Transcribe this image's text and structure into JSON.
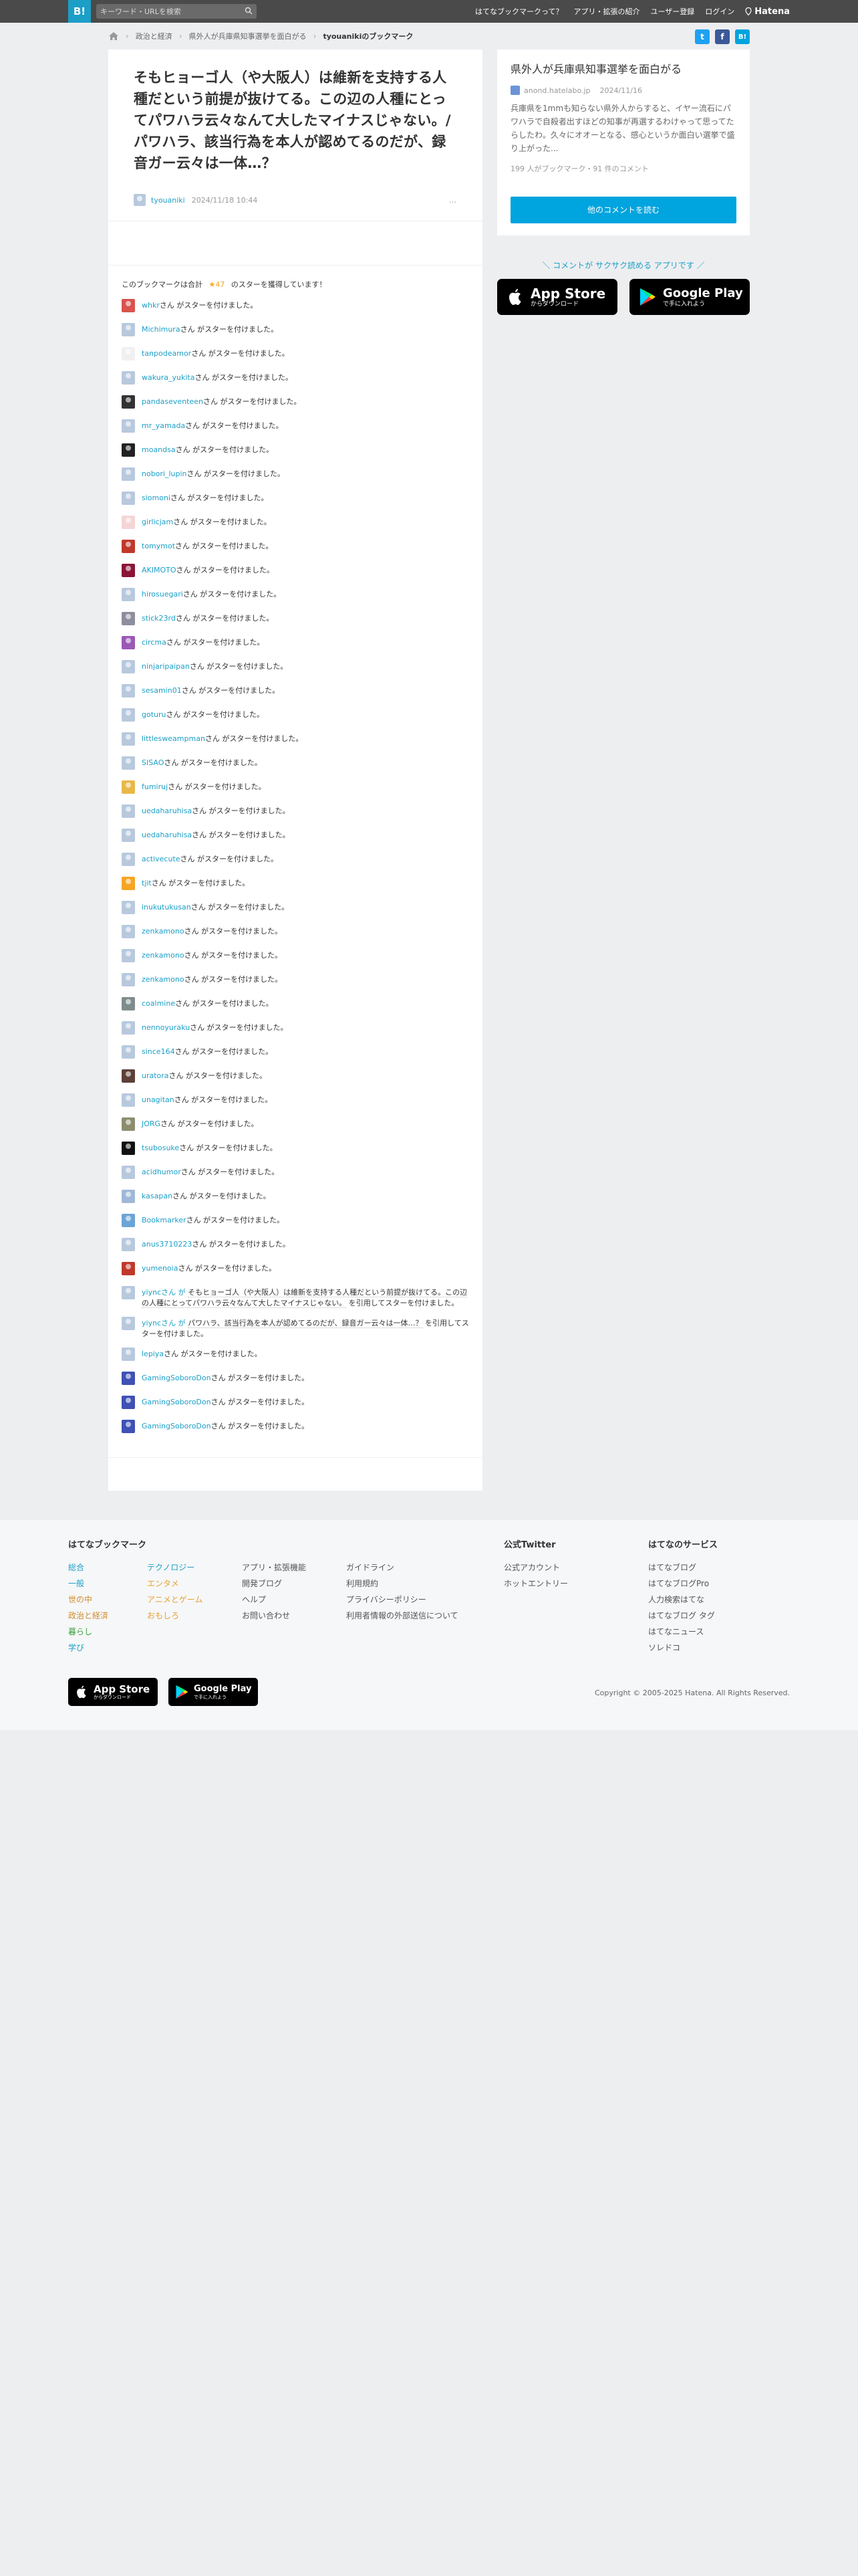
{
  "topbar": {
    "logo": "B!",
    "search_placeholder": "キーワード・URLを検索",
    "nav": [
      "はてなブックマークって？",
      "アプリ・拡張の紹介",
      "ユーザー登録",
      "ログイン"
    ],
    "brand": "Hatena"
  },
  "breadcrumb": {
    "items": [
      "政治と経済",
      "県外人が兵庫県知事選挙を面白がる"
    ],
    "current": "tyouanikiのブックマーク"
  },
  "share": {
    "twitter": "t",
    "facebook": "f",
    "hatena": "B!"
  },
  "entry": {
    "title": "そもヒョーゴ人（や大阪人）は維新を支持する人種だという前提が抜けてる。この辺の人種にとってパワハラ云々なんて大したマイナスじゃない。/パワハラ、該当行為を本人が認めてるのだが、録音ガー云々は一体…？",
    "user": "tyouaniki",
    "date": "2024/11/18 10:44",
    "more": "…"
  },
  "stars": {
    "summary_prefix": "このブックマークは合計",
    "summary_count": "★47",
    "summary_suffix": "のスターを獲得しています！",
    "suffix": "さん がスターを付けました。",
    "rows": [
      {
        "u": "whkr",
        "c": "#d9534f"
      },
      {
        "u": "Michimura",
        "c": "#b8c9de"
      },
      {
        "u": "tanpodeamor",
        "c": "#f0f0f0"
      },
      {
        "u": "wakura_yukita",
        "c": "#b8c9de"
      },
      {
        "u": "pandaseventeen",
        "c": "#333333"
      },
      {
        "u": "mr_yamada",
        "c": "#b8c9de"
      },
      {
        "u": "moandsa",
        "c": "#222222"
      },
      {
        "u": "nobori_lupin",
        "c": "#b8c9de"
      },
      {
        "u": "siomoni",
        "c": "#b8c9de"
      },
      {
        "u": "girlicjam",
        "c": "#f5d5d5"
      },
      {
        "u": "tomymot",
        "c": "#c0392b"
      },
      {
        "u": "AKIMOTO",
        "c": "#8b1538"
      },
      {
        "u": "hirosuegari",
        "c": "#b8c9de"
      },
      {
        "u": "stick23rd",
        "c": "#8e8e9e"
      },
      {
        "u": "circma",
        "c": "#9b59b6"
      },
      {
        "u": "ninjaripaipan",
        "c": "#b8c9de"
      },
      {
        "u": "sesamin01",
        "c": "#b8c9de"
      },
      {
        "u": "goturu",
        "c": "#b8c9de"
      },
      {
        "u": "littlesweampman",
        "c": "#b8c9de"
      },
      {
        "u": "SISAO",
        "c": "#b8c9de"
      },
      {
        "u": "fumiruj",
        "c": "#e8b84a"
      },
      {
        "u": "uedaharuhisa",
        "c": "#b8c9de"
      },
      {
        "u": "uedaharuhisa",
        "c": "#b8c9de"
      },
      {
        "u": "activecute",
        "c": "#b8c9de"
      },
      {
        "u": "tjit",
        "c": "#f5a623"
      },
      {
        "u": "inukutukusan",
        "c": "#b8c9de"
      },
      {
        "u": "zenkamono",
        "c": "#b8c9de"
      },
      {
        "u": "zenkamono",
        "c": "#b8c9de"
      },
      {
        "u": "zenkamono",
        "c": "#b8c9de"
      },
      {
        "u": "coalmine",
        "c": "#7f8c8d"
      },
      {
        "u": "nennoyuraku",
        "c": "#b8c9de"
      },
      {
        "u": "since164",
        "c": "#b8c9de"
      },
      {
        "u": "uratora",
        "c": "#5d4037"
      },
      {
        "u": "unagitan",
        "c": "#b8c9de"
      },
      {
        "u": "JORG",
        "c": "#8d8d6e"
      },
      {
        "u": "tsubosuke",
        "c": "#111111"
      },
      {
        "u": "acidhumor",
        "c": "#b8c9de"
      },
      {
        "u": "kasapan",
        "c": "#a0b8d8"
      },
      {
        "u": "Bookmarker",
        "c": "#6ba5d6"
      },
      {
        "u": "anus3710223",
        "c": "#b8c9de"
      },
      {
        "u": "yumenoia",
        "c": "#c0392b"
      }
    ],
    "quote1": {
      "user": "yiyncさん が",
      "quote": "そもヒョーゴ人（や大阪人）は維新を支持する人種だという前提が抜けてる。この辺の人種にとってパワハラ云々なんて大したマイナスじゃない。",
      "suffix": "を引用してスターを付けました。",
      "c": "#b8c9de"
    },
    "quote2": {
      "user": "yiyncさん が",
      "quote": "パワハラ、該当行為を本人が認めてるのだが、録音ガー云々は一体…？",
      "suffix": "を引用してスターを付けました。",
      "c": "#b8c9de"
    },
    "tail_rows": [
      {
        "u": "lepiya",
        "c": "#b8c9de"
      },
      {
        "u": "GamingSoboroDon",
        "c": "#3f51b5"
      },
      {
        "u": "GamingSoboroDon",
        "c": "#3f51b5"
      },
      {
        "u": "GamingSoboroDon",
        "c": "#3f51b5"
      }
    ]
  },
  "card": {
    "title": "県外人が兵庫県知事選挙を面白がる",
    "domain": "anond.hatelabo.jp",
    "date": "2024/11/16",
    "desc": "兵庫県を1mmも知らない県外人からすると、イヤー流石にパワハラで自殺者出すほどの知事が再選するわけゃって思ってたらしたわ。久々にオオーとなる、感心というか面白い選挙で盛り上がった...",
    "stats": "199 人がブックマーク・91 件のコメント",
    "read_button": "他のコメントを読む"
  },
  "promo": {
    "text": "＼ コメントが サクサク読める アプリです ／",
    "appstore_big": "App Store",
    "appstore_small": "からダウンロード",
    "google_big": "Google Play",
    "google_small": "で手に入れよう"
  },
  "footer": {
    "title1": "はてなブックマーク",
    "col1": [
      "総合",
      "一般",
      "世の中",
      "政治と経済",
      "暮らし",
      "学び"
    ],
    "col2": [
      "テクノロジー",
      "エンタメ",
      "アニメとゲーム",
      "おもしろ"
    ],
    "col3": [
      "アプリ・拡張機能",
      "開発ブログ",
      "ヘルプ",
      "お問い合わせ"
    ],
    "col4": [
      "ガイドライン",
      "利用規約",
      "プライバシーポリシー",
      "利用者情報の外部送信について"
    ],
    "title2": "公式Twitter",
    "twitter": [
      "公式アカウント",
      "ホットエントリー"
    ],
    "title3": "はてなのサービス",
    "services": [
      "はてなブログ",
      "はてなブログPro",
      "人力検索はてな",
      "はてなブログ タグ",
      "はてなニュース",
      "ソレドコ"
    ],
    "copyright": "Copyright © 2005-2025 Hatena. All Rights Reserved.",
    "appstore_big": "App Store",
    "appstore_small": "からダウンロード",
    "google_big": "Google Play",
    "google_small": "で手に入れよう"
  },
  "colors": {
    "accent": "#1c9fc7",
    "topbar": "#4a4a4a",
    "button": "#00a4de",
    "star": "#f5a623",
    "twitter": "#1da1f2",
    "facebook": "#3b5998",
    "hatena": "#00a4de"
  }
}
